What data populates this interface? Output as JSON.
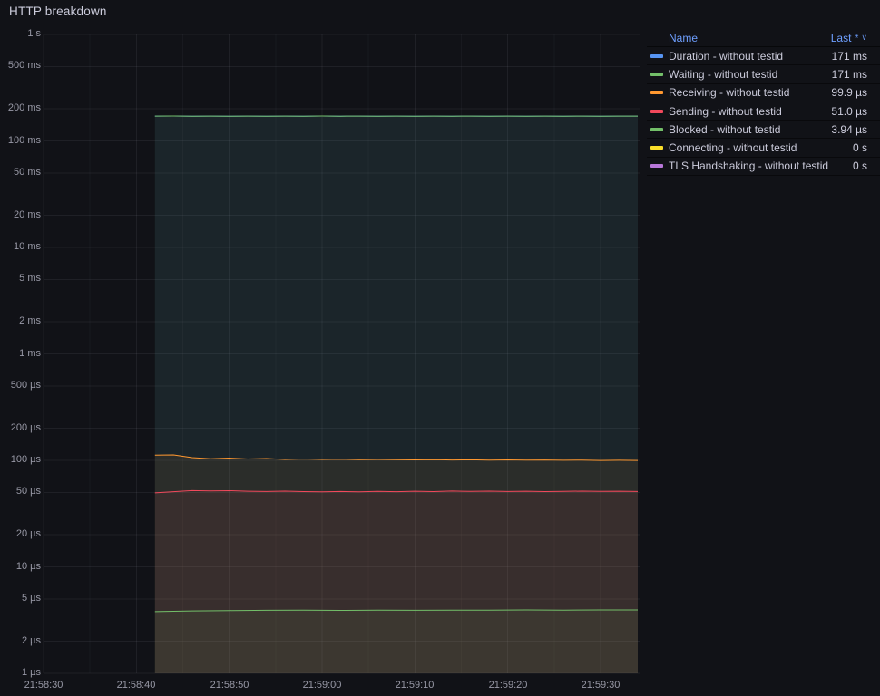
{
  "panel": {
    "title": "HTTP breakdown"
  },
  "legend": {
    "name_header": "Name",
    "value_header": "Last *",
    "sort_caret": "∨",
    "header_color": "#6e9fff",
    "rows": [
      {
        "name": "Duration - without testid",
        "value": "171 ms",
        "color": "#5794F2"
      },
      {
        "name": "Waiting - without testid",
        "value": "171 ms",
        "color": "#73BF69"
      },
      {
        "name": "Receiving - without testid",
        "value": "99.9 µs",
        "color": "#FF9830"
      },
      {
        "name": "Sending - without testid",
        "value": "51.0 µs",
        "color": "#F2495C"
      },
      {
        "name": "Blocked - without testid",
        "value": "3.94 µs",
        "color": "#73BF69"
      },
      {
        "name": "Connecting - without testid",
        "value": "0 s",
        "color": "#FADE2A"
      },
      {
        "name": "TLS Handshaking - without testid",
        "value": "0 s",
        "color": "#B877D9"
      }
    ]
  },
  "chart_data": {
    "type": "line",
    "title": "HTTP breakdown",
    "y_scale": "log",
    "grid": true,
    "legend_position": "right-table",
    "xlim": [
      0,
      64.2
    ],
    "ylim": [
      1e-06,
      1
    ],
    "x_ticks": [
      {
        "t": 0,
        "label": "21:58:30"
      },
      {
        "t": 10,
        "label": "21:58:40"
      },
      {
        "t": 20,
        "label": "21:58:50"
      },
      {
        "t": 30,
        "label": "21:59:00"
      },
      {
        "t": 40,
        "label": "21:59:10"
      },
      {
        "t": 50,
        "label": "21:59:20"
      },
      {
        "t": 60,
        "label": "21:59:30"
      }
    ],
    "y_ticks": [
      {
        "v": 1,
        "label": "1 s"
      },
      {
        "v": 0.5,
        "label": "500 ms"
      },
      {
        "v": 0.2,
        "label": "200 ms"
      },
      {
        "v": 0.1,
        "label": "100 ms"
      },
      {
        "v": 0.05,
        "label": "50 ms"
      },
      {
        "v": 0.02,
        "label": "20 ms"
      },
      {
        "v": 0.01,
        "label": "10 ms"
      },
      {
        "v": 0.005,
        "label": "5 ms"
      },
      {
        "v": 0.002,
        "label": "2 ms"
      },
      {
        "v": 0.001,
        "label": "1 ms"
      },
      {
        "v": 0.0005,
        "label": "500 µs"
      },
      {
        "v": 0.0002,
        "label": "200 µs"
      },
      {
        "v": 0.0001,
        "label": "100 µs"
      },
      {
        "v": 5e-05,
        "label": "50 µs"
      },
      {
        "v": 2e-05,
        "label": "20 µs"
      },
      {
        "v": 1e-05,
        "label": "10 µs"
      },
      {
        "v": 5e-06,
        "label": "5 µs"
      },
      {
        "v": 2e-06,
        "label": "2 µs"
      },
      {
        "v": 1e-06,
        "label": "1 µs"
      }
    ],
    "series": [
      {
        "name": "Duration - without testid",
        "color": "#5794F2",
        "fill_opacity": 0.07,
        "last": "171 ms",
        "points": [
          [
            12,
            0.171
          ],
          [
            14,
            0.1713
          ],
          [
            16,
            0.1709
          ],
          [
            18,
            0.1712
          ],
          [
            20,
            0.1708
          ],
          [
            22,
            0.1711
          ],
          [
            24,
            0.1707
          ],
          [
            26,
            0.1712
          ],
          [
            28,
            0.1709
          ],
          [
            30,
            0.1713
          ],
          [
            32,
            0.1708
          ],
          [
            34,
            0.171
          ],
          [
            36,
            0.1707
          ],
          [
            38,
            0.1711
          ],
          [
            40,
            0.1709
          ],
          [
            42,
            0.1712
          ],
          [
            44,
            0.1708
          ],
          [
            46,
            0.171
          ],
          [
            48,
            0.1706
          ],
          [
            50,
            0.1711
          ],
          [
            52,
            0.1709
          ],
          [
            54,
            0.1712
          ],
          [
            56,
            0.1708
          ],
          [
            58,
            0.1711
          ],
          [
            60,
            0.1709
          ],
          [
            62,
            0.171
          ],
          [
            64,
            0.171
          ]
        ]
      },
      {
        "name": "Waiting - without testid",
        "color": "#73BF69",
        "fill_opacity": 0.07,
        "last": "171 ms",
        "points": [
          [
            12,
            0.171
          ],
          [
            14,
            0.1713
          ],
          [
            16,
            0.1709
          ],
          [
            18,
            0.1712
          ],
          [
            20,
            0.1708
          ],
          [
            22,
            0.1711
          ],
          [
            24,
            0.1707
          ],
          [
            26,
            0.1712
          ],
          [
            28,
            0.1709
          ],
          [
            30,
            0.1713
          ],
          [
            32,
            0.1708
          ],
          [
            34,
            0.171
          ],
          [
            36,
            0.1707
          ],
          [
            38,
            0.1711
          ],
          [
            40,
            0.1709
          ],
          [
            42,
            0.1712
          ],
          [
            44,
            0.1708
          ],
          [
            46,
            0.171
          ],
          [
            48,
            0.1706
          ],
          [
            50,
            0.1711
          ],
          [
            52,
            0.1709
          ],
          [
            54,
            0.1712
          ],
          [
            56,
            0.1708
          ],
          [
            58,
            0.1711
          ],
          [
            60,
            0.1709
          ],
          [
            62,
            0.171
          ],
          [
            64,
            0.171
          ]
        ]
      },
      {
        "name": "Receiving - without testid",
        "color": "#FF9830",
        "fill_opacity": 0.07,
        "last": "99.9 µs",
        "points": [
          [
            12,
            0.000112
          ],
          [
            14,
            0.0001125
          ],
          [
            16,
            0.000106
          ],
          [
            18,
            0.0001035
          ],
          [
            20,
            0.000105
          ],
          [
            22,
            0.000103
          ],
          [
            24,
            0.000104
          ],
          [
            26,
            0.000102
          ],
          [
            28,
            0.000103
          ],
          [
            30,
            0.000102
          ],
          [
            32,
            0.0001025
          ],
          [
            34,
            0.0001015
          ],
          [
            36,
            0.000102
          ],
          [
            38,
            0.0001015
          ],
          [
            40,
            0.000101
          ],
          [
            42,
            0.0001015
          ],
          [
            44,
            0.0001008
          ],
          [
            46,
            0.0001012
          ],
          [
            48,
            0.0001006
          ],
          [
            50,
            0.000101
          ],
          [
            52,
            0.0001004
          ],
          [
            54,
            0.0001008
          ],
          [
            56,
            0.0001002
          ],
          [
            58,
            0.0001006
          ],
          [
            60,
            9.99e-05
          ],
          [
            62,
            0.0001002
          ],
          [
            64,
            9.99e-05
          ]
        ]
      },
      {
        "name": "Sending - without testid",
        "color": "#F2495C",
        "fill_opacity": 0.07,
        "last": "51.0 µs",
        "points": [
          [
            12,
            4.95e-05
          ],
          [
            14,
            5.08e-05
          ],
          [
            16,
            5.2e-05
          ],
          [
            18,
            5.16e-05
          ],
          [
            20,
            5.19e-05
          ],
          [
            22,
            5.13e-05
          ],
          [
            24,
            5.1e-05
          ],
          [
            26,
            5.14e-05
          ],
          [
            28,
            5.09e-05
          ],
          [
            30,
            5.06e-05
          ],
          [
            32,
            5.1e-05
          ],
          [
            34,
            5.07e-05
          ],
          [
            36,
            5.12e-05
          ],
          [
            38,
            5.08e-05
          ],
          [
            40,
            5.13e-05
          ],
          [
            42,
            5.09e-05
          ],
          [
            44,
            5.15e-05
          ],
          [
            46,
            5.11e-05
          ],
          [
            48,
            5.14e-05
          ],
          [
            50,
            5.1e-05
          ],
          [
            52,
            5.13e-05
          ],
          [
            54,
            5.09e-05
          ],
          [
            56,
            5.12e-05
          ],
          [
            58,
            5.14e-05
          ],
          [
            60,
            5.11e-05
          ],
          [
            62,
            5.13e-05
          ],
          [
            64,
            5.1e-05
          ]
        ]
      },
      {
        "name": "Blocked - without testid",
        "color": "#73BF69",
        "fill_opacity": 0.07,
        "last": "3.94 µs",
        "points": [
          [
            12,
            3.8e-06
          ],
          [
            16,
            3.86e-06
          ],
          [
            20,
            3.89e-06
          ],
          [
            24,
            3.91e-06
          ],
          [
            28,
            3.93e-06
          ],
          [
            32,
            3.9e-06
          ],
          [
            36,
            3.92e-06
          ],
          [
            40,
            3.91e-06
          ],
          [
            44,
            3.93e-06
          ],
          [
            48,
            3.92e-06
          ],
          [
            52,
            3.94e-06
          ],
          [
            56,
            3.93e-06
          ],
          [
            60,
            3.94e-06
          ],
          [
            64,
            3.94e-06
          ]
        ]
      },
      {
        "name": "Connecting - without testid",
        "color": "#FADE2A",
        "fill_opacity": 0.07,
        "last": "0 s",
        "points": []
      },
      {
        "name": "TLS Handshaking - without testid",
        "color": "#B877D9",
        "fill_opacity": 0.07,
        "last": "0 s",
        "points": []
      }
    ]
  }
}
